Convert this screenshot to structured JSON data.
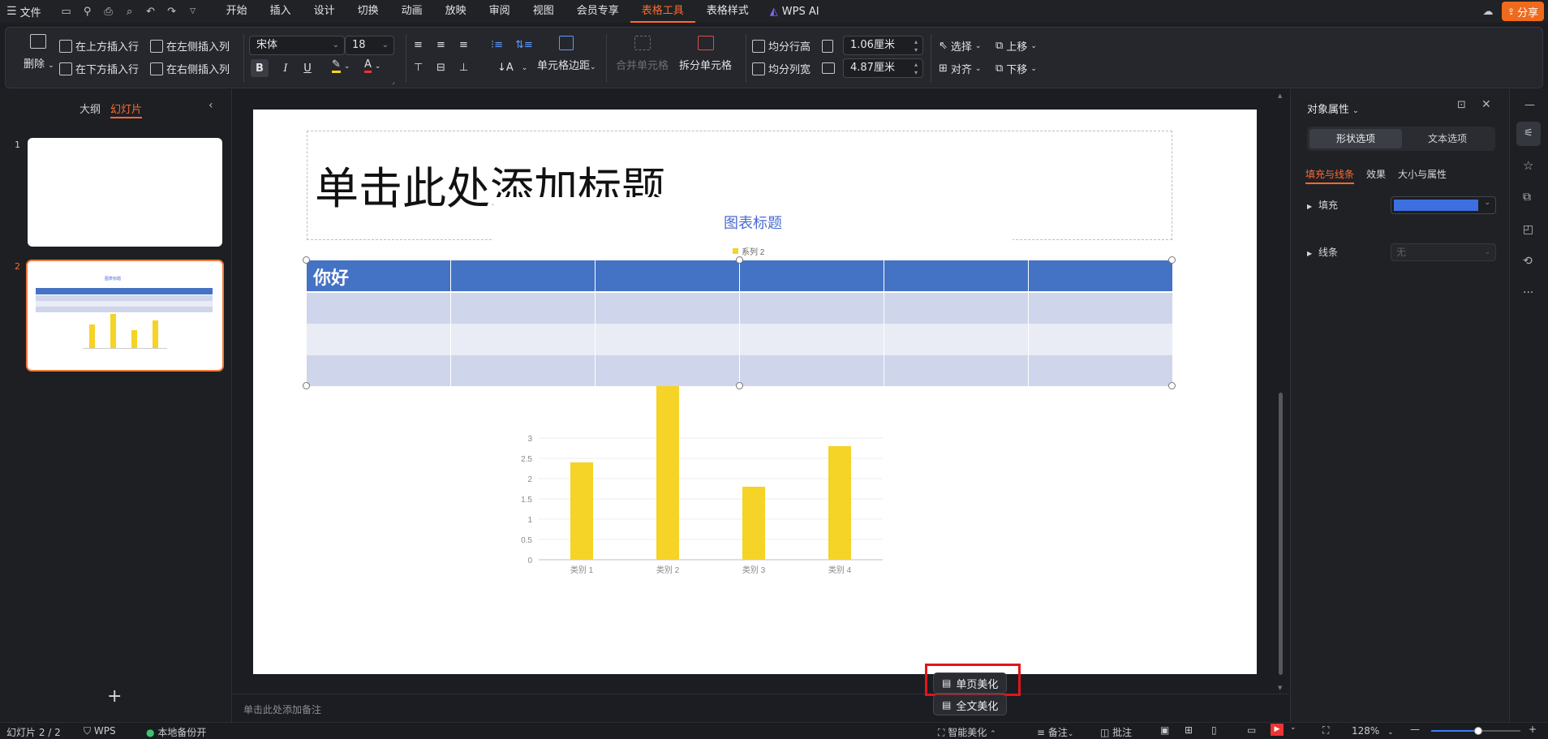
{
  "menubar": {
    "file": "文件",
    "tabs": [
      "开始",
      "插入",
      "设计",
      "切换",
      "动画",
      "放映",
      "审阅",
      "视图",
      "会员专享",
      "表格工具",
      "表格样式"
    ],
    "active_tab": "表格工具",
    "wps_ai": "WPS AI",
    "share": "分享"
  },
  "ribbon": {
    "delete": "删除",
    "insert_row_above": "在上方插入行",
    "insert_row_below": "在下方插入行",
    "insert_col_left": "在左侧插入列",
    "insert_col_right": "在右侧插入列",
    "font_name": "宋体",
    "font_size": "18",
    "cell_margin": "单元格边距",
    "merge_cells": "合并单元格",
    "split_cells": "拆分单元格",
    "distribute_rows": "均分行高",
    "distribute_cols": "均分列宽",
    "row_height": "1.06厘米",
    "col_width": "4.87厘米",
    "select": "选择",
    "align": "对齐",
    "move_up": "上移",
    "move_down": "下移"
  },
  "leftpanel": {
    "tab_outline": "大纲",
    "tab_slides": "幻灯片",
    "slides": [
      "1",
      "2"
    ],
    "thumb2_title": "图表标题",
    "add": "+"
  },
  "slide": {
    "title_placeholder": "单击此处添加标题",
    "table_header_cell": "你好",
    "notes_placeholder": "单击此处添加备注"
  },
  "chart_data": {
    "type": "bar",
    "title": "图表标题",
    "categories": [
      "类别 1",
      "类别 2",
      "类别 3",
      "类别 4"
    ],
    "series": [
      {
        "name": "系列 2",
        "values": [
          2.4,
          4.4,
          1.8,
          2.8
        ],
        "color": "#f5d327"
      }
    ],
    "yticks": [
      "0",
      "0.5",
      "1",
      "1.5",
      "2",
      "2.5",
      "3"
    ],
    "ylim": [
      0,
      3
    ],
    "grid": true,
    "legend": "top"
  },
  "popup": {
    "single_page": "单页美化",
    "full_doc": "全文美化"
  },
  "rightpanel": {
    "title": "对象属性",
    "tab_shape": "形状选项",
    "tab_text": "文本选项",
    "sub_fill_line": "填充与线条",
    "sub_effect": "效果",
    "sub_size": "大小与属性",
    "fill_label": "填充",
    "line_label": "线条",
    "line_value": "无",
    "fill_color": "#3d6fe0"
  },
  "statusbar": {
    "slide_info": "幻灯片 2 / 2",
    "wps": "WPS",
    "backup": "本地备份开",
    "smart_beautify": "智能美化",
    "notes": "备注",
    "comments": "批注",
    "zoom": "128%"
  },
  "colors": {
    "accent": "#ff6a2c",
    "table_header": "#4472c4",
    "table_row_a": "#cfd5ea",
    "table_row_b": "#e9ebf5"
  }
}
